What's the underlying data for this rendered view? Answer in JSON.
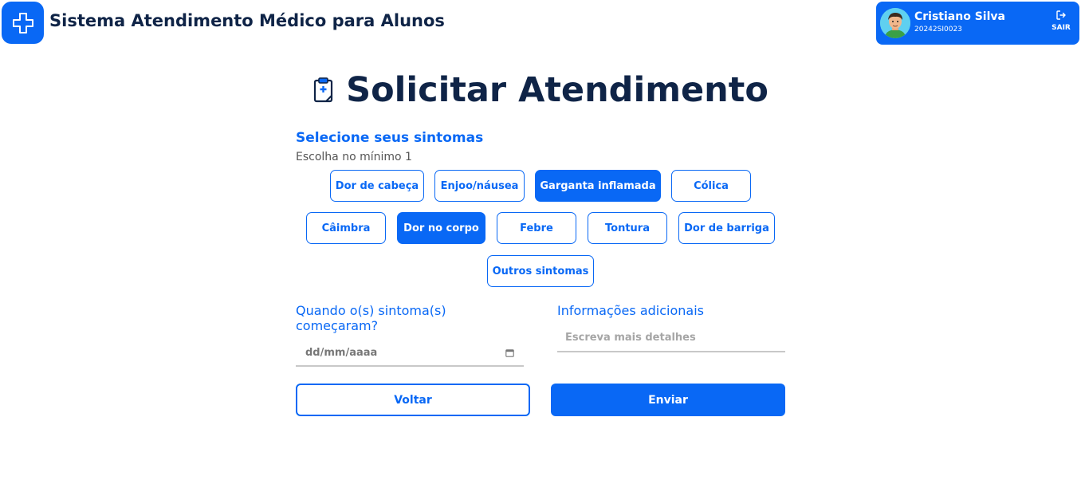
{
  "header": {
    "title": "Sistema Atendimento Médico para Alunos",
    "logo_icon": "medical-cross-icon"
  },
  "user": {
    "name": "Cristiano Silva",
    "id": "20242SI0023",
    "logout_label": "SAIR",
    "logout_icon": "logout-icon"
  },
  "page": {
    "title": "Solicitar Atendimento",
    "title_icon": "clipboard-medical-icon"
  },
  "symptoms": {
    "title": "Selecione seus sintomas",
    "subtitle": "Escolha no mínimo 1",
    "options": [
      {
        "label": "Dor de cabeça",
        "selected": false
      },
      {
        "label": "Enjoo/náusea",
        "selected": false
      },
      {
        "label": "Garganta inflamada",
        "selected": true
      },
      {
        "label": "Cólica",
        "selected": false
      },
      {
        "label": "Câimbra",
        "selected": false
      },
      {
        "label": "Dor no corpo",
        "selected": true
      },
      {
        "label": "Febre",
        "selected": false
      },
      {
        "label": "Tontura",
        "selected": false
      },
      {
        "label": "Dor de barriga",
        "selected": false
      },
      {
        "label": "Outros sintomas",
        "selected": false
      }
    ]
  },
  "form": {
    "start_label": "Quando o(s) sintoma(s) começaram?",
    "date_placeholder": "dd/mm/aaaa",
    "info_label": "Informações adicionais",
    "info_placeholder": "Escreva mais detalhes"
  },
  "actions": {
    "back_label": "Voltar",
    "send_label": "Enviar"
  },
  "colors": {
    "primary": "#0968f5",
    "heading": "#0f2447"
  }
}
